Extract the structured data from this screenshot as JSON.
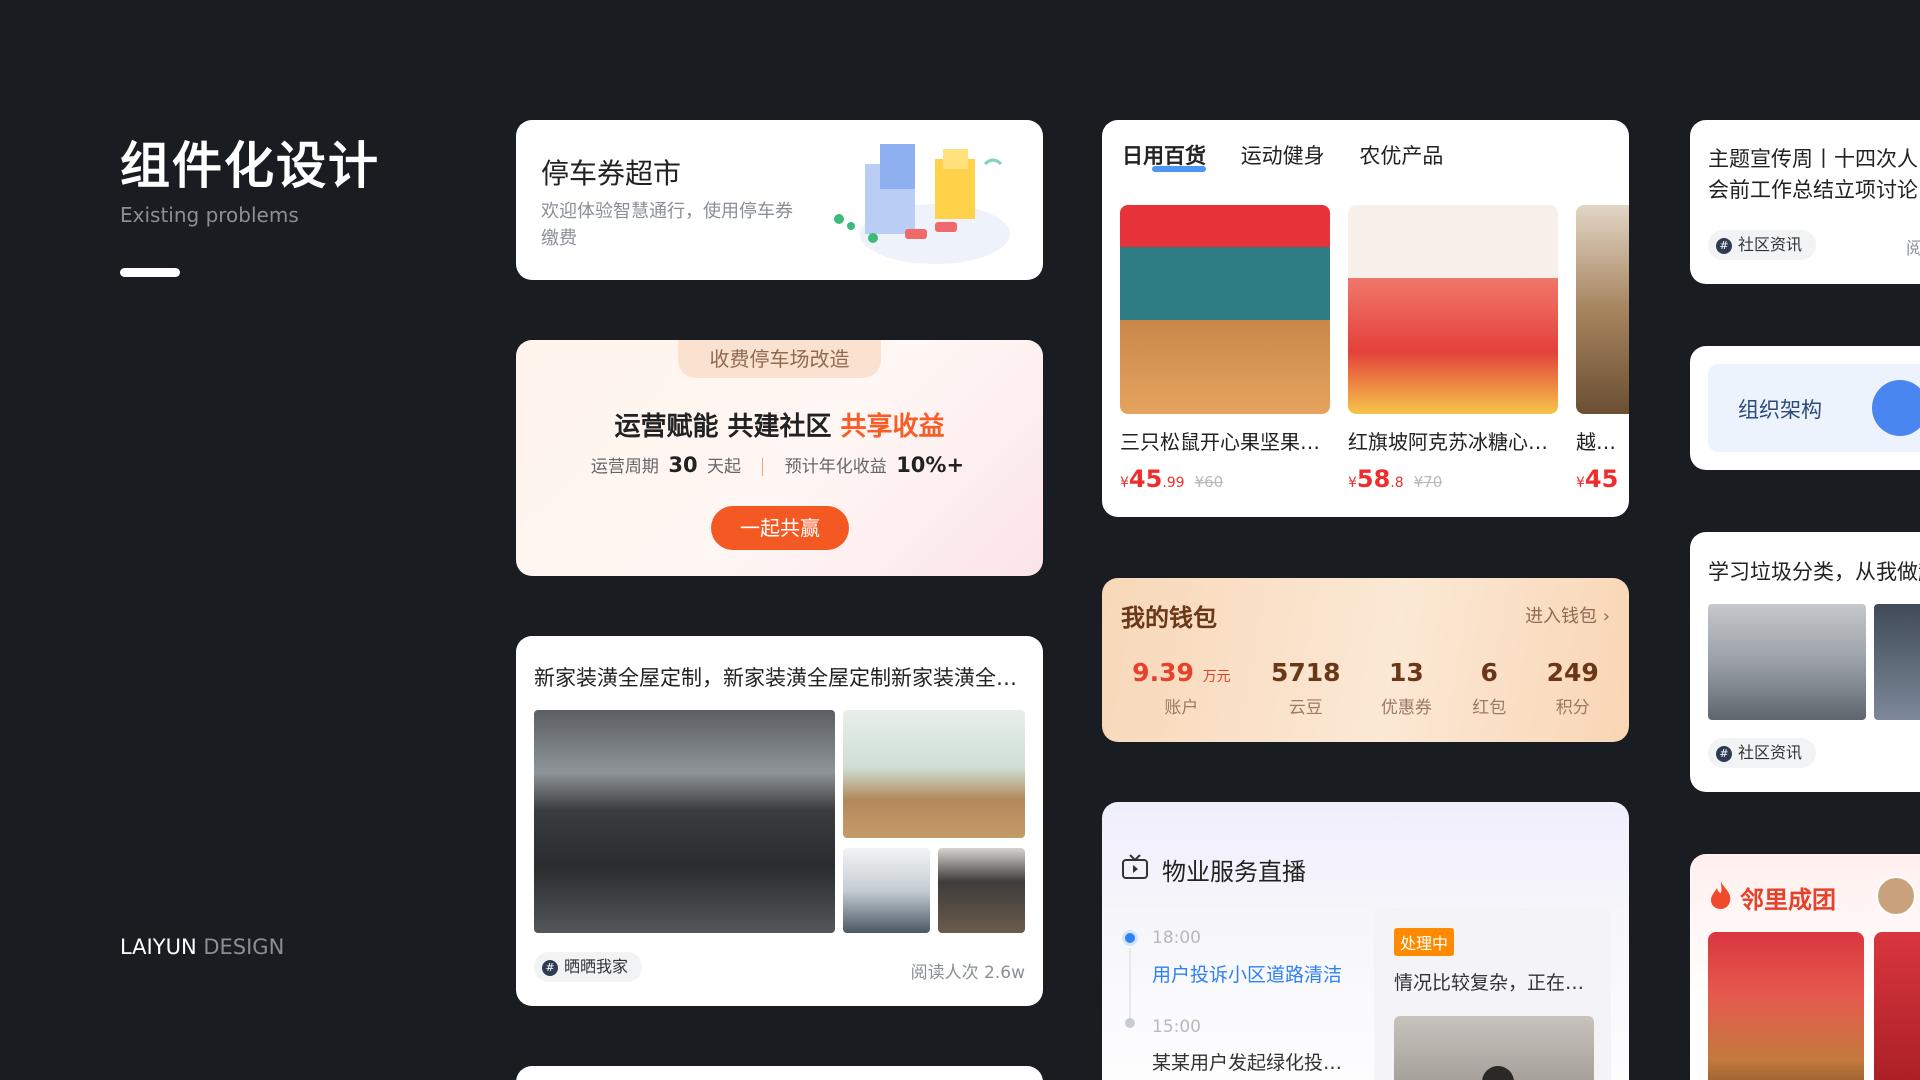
{
  "hero": {
    "title": "组件化设计",
    "subtitle": "Existing problems",
    "brand_a": "LAIYUN",
    "brand_b": " DESIGN"
  },
  "parking": {
    "title": "停车券超市",
    "desc": "欢迎体验智慧通行，使用停车券缴费"
  },
  "invest": {
    "tab": "收费停车场改造",
    "headline_a": "运营赋能 共建社区 ",
    "headline_b": "共享收益",
    "period_label": "运营周期",
    "period_value": "30",
    "period_unit": "天起",
    "yield_label": "预计年化收益",
    "yield_value": "10%+",
    "button": "一起共赢"
  },
  "post": {
    "title": "新家装潢全屋定制，新家装潢全屋定制新家装潢全屋定制",
    "tag": "晒晒我家",
    "reads": "阅读人次 2.6w"
  },
  "shop": {
    "tabs": [
      "日用百货",
      "运动健身",
      "农优产品"
    ],
    "products": [
      {
        "name": "三只松鼠开心果坚果礼盒",
        "price_int": "45",
        "price_dec": ".99",
        "old": "¥60",
        "color1": "#e8323a",
        "color2": "#2e7d84"
      },
      {
        "name": "红旗坡阿克苏冰糖心苹果",
        "price_int": "58",
        "price_dec": ".8",
        "old": "¥70",
        "color1": "#f7efe9",
        "color2": "#e4413a"
      },
      {
        "name": "越南进口",
        "price_int": "45",
        "price_dec": "",
        "old": "",
        "color1": "#e2d6c6",
        "color2": "#8a6a47"
      }
    ],
    "currency": "¥"
  },
  "wallet": {
    "title": "我的钱包",
    "more": "进入钱包",
    "stats": [
      {
        "value": "9.39",
        "unit": "万元",
        "label": "账户"
      },
      {
        "value": "5718",
        "unit": "",
        "label": "云豆"
      },
      {
        "value": "13",
        "unit": "",
        "label": "优惠券"
      },
      {
        "value": "6",
        "unit": "",
        "label": "红包"
      },
      {
        "value": "249",
        "unit": "",
        "label": "积分"
      }
    ]
  },
  "live": {
    "title": "物业服务直播",
    "time1": "18:00",
    "event1": "用户投诉小区道路清洁",
    "time2": "15:00",
    "event2": "某某用户发起绿化投诉处理",
    "badge": "处理中",
    "panel_desc": "情况比较复杂，正在处理中"
  },
  "news": {
    "title_1": "主题宣传周丨十四次人",
    "title_2": "会前工作总结立项讨论",
    "tag": "社区资讯",
    "read": "阅"
  },
  "org": {
    "label": "组织架构"
  },
  "garbage": {
    "title": "学习垃圾分类，从我做起",
    "tag": "社区资讯"
  },
  "group": {
    "title": "邻里成团"
  },
  "colors": {
    "accent_blue": "#2e82f6",
    "accent_orange": "#f55923",
    "price_red": "#f02d2d"
  }
}
